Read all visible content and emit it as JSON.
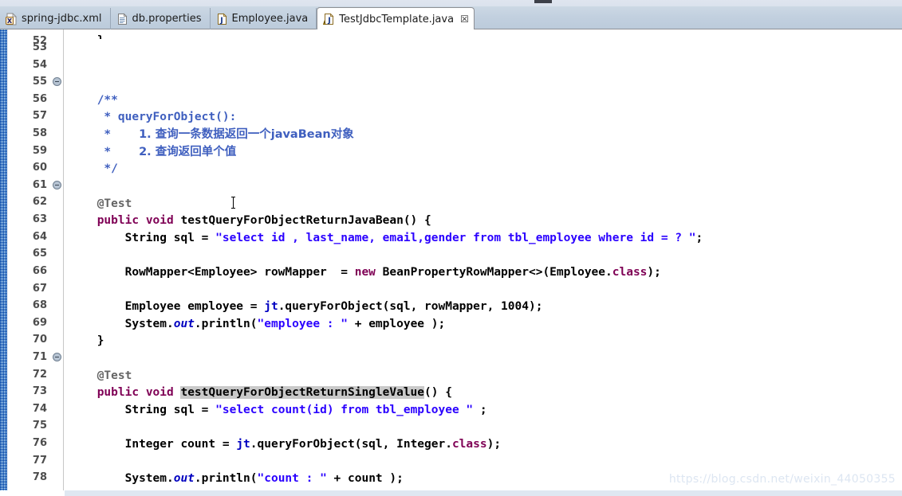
{
  "window": {
    "tabs": [
      {
        "label": "spring-jdbc.xml",
        "icon": "xml-file-icon",
        "active": false,
        "closable": false
      },
      {
        "label": "db.properties",
        "icon": "properties-file-icon",
        "active": false,
        "closable": false
      },
      {
        "label": "Employee.java",
        "icon": "java-file-icon",
        "active": false,
        "closable": false
      },
      {
        "label": "TestJdbcTemplate.java",
        "icon": "java-file-warning-icon",
        "active": true,
        "closable": true
      }
    ],
    "close_glyph": "☒"
  },
  "editor": {
    "first_visible_line": 52,
    "last_visible_line": 78,
    "highlighted_occurrence": "testQueryForObjectReturnSingleValue",
    "lines": [
      {
        "n": 52,
        "fold": false,
        "partial": true,
        "text": "    }"
      },
      {
        "n": 53,
        "fold": false,
        "text": ""
      },
      {
        "n": 54,
        "fold": false,
        "text": ""
      },
      {
        "n": 55,
        "fold": true,
        "text": "    /**"
      },
      {
        "n": 56,
        "fold": false,
        "text": "     * queryForObject():"
      },
      {
        "n": 57,
        "fold": false,
        "text": "     *    1. 查询一条数据返回一个javaBean对象"
      },
      {
        "n": 58,
        "fold": false,
        "text": "     *    2. 查询返回单个值"
      },
      {
        "n": 59,
        "fold": false,
        "text": "     */"
      },
      {
        "n": 60,
        "fold": false,
        "text": ""
      },
      {
        "n": 61,
        "fold": true,
        "text": "    @Test"
      },
      {
        "n": 62,
        "fold": false,
        "text": "    public void testQueryForObjectReturnJavaBean() {"
      },
      {
        "n": 63,
        "fold": false,
        "text": "        String sql = \"select id , last_name, email,gender from tbl_employee where id = ? \";"
      },
      {
        "n": 64,
        "fold": false,
        "text": ""
      },
      {
        "n": 65,
        "fold": false,
        "text": "        RowMapper<Employee> rowMapper  = new BeanPropertyRowMapper<>(Employee.class);"
      },
      {
        "n": 66,
        "fold": false,
        "text": ""
      },
      {
        "n": 67,
        "fold": false,
        "text": "        Employee employee = jt.queryForObject(sql, rowMapper, 1004);"
      },
      {
        "n": 68,
        "fold": false,
        "text": "        System.out.println(\"employee : \" + employee );"
      },
      {
        "n": 69,
        "fold": false,
        "text": "    }"
      },
      {
        "n": 70,
        "fold": false,
        "text": ""
      },
      {
        "n": 71,
        "fold": true,
        "text": "    @Test"
      },
      {
        "n": 72,
        "fold": false,
        "text": "    public void testQueryForObjectReturnSingleValue() {"
      },
      {
        "n": 73,
        "fold": false,
        "text": "        String sql = \"select count(id) from tbl_employee \" ;"
      },
      {
        "n": 74,
        "fold": false,
        "text": ""
      },
      {
        "n": 75,
        "fold": false,
        "text": "        Integer count = jt.queryForObject(sql, Integer.class);"
      },
      {
        "n": 76,
        "fold": false,
        "text": ""
      },
      {
        "n": 77,
        "fold": false,
        "text": "        System.out.println(\"count : \" + count );"
      },
      {
        "n": 78,
        "fold": false,
        "text": "    }"
      }
    ],
    "tokens": {
      "l52": {
        "brace": "}"
      },
      "l55": {
        "javadoc_open": "/**"
      },
      "l56": {
        "star": "*",
        "text": "queryForObject():"
      },
      "l57": {
        "star": "*",
        "text": "1. 查询一条数据返回一个javaBean对象"
      },
      "l58": {
        "star": "*",
        "text": "2. 查询返回单个值"
      },
      "l59": {
        "javadoc_close": "*/"
      },
      "l61": {
        "annotation": "@Test"
      },
      "l62": {
        "kw1": "public",
        "kw2": "void",
        "name": "testQueryForObjectReturnJavaBean",
        "tail": "() {"
      },
      "l63": {
        "type": "String",
        "var": "sql",
        "eq": " = ",
        "string": "\"select id , last_name, email,gender from tbl_employee where id = ? \"",
        "semi": ";"
      },
      "l65": {
        "type": "RowMapper<Employee>",
        "var": "rowMapper",
        "eq": "  = ",
        "kw": "new",
        "ctor": "BeanPropertyRowMapper<>(Employee.",
        "clskw": "class",
        "tail": ");"
      },
      "l67": {
        "type": "Employee",
        "var": "employee",
        "eq": " = ",
        "field": "jt",
        "call": ".queryForObject(sql, rowMapper, 1004);"
      },
      "l68": {
        "sys": "System.",
        "out": "out",
        "print": ".println(",
        "string": "\"employee : \"",
        "tail": " + employee );"
      },
      "l69": {
        "brace": "}"
      },
      "l71": {
        "annotation": "@Test"
      },
      "l72": {
        "kw1": "public",
        "kw2": "void",
        "name": "testQueryForObjectReturnSingleValue",
        "tail": "() {"
      },
      "l73": {
        "type": "String",
        "var": "sql",
        "eq": " = ",
        "string": "\"select count(id) from tbl_employee \"",
        "semi": " ;"
      },
      "l75": {
        "type": "Integer",
        "var": "count",
        "eq": " = ",
        "field": "jt",
        "call": ".queryForObject(sql, Integer.",
        "clskw": "class",
        "tail": ");"
      },
      "l77": {
        "sys": "System.",
        "out": "out",
        "print": ".println(",
        "string": "\"count : \"",
        "tail": " + count );"
      },
      "l78": {
        "brace": "}"
      }
    }
  },
  "watermark": {
    "text": "https://blog.csdn.net/weixin_44050355"
  },
  "colors": {
    "keyword": "#7f0055",
    "string": "#2a00ff",
    "comment": "#3f5fbf",
    "field": "#0000c0",
    "annotation": "#646464",
    "occurrence_highlight": "#c9c9c9",
    "tabbar": "#c2d0df",
    "annotation_strip": "#1b6fc4"
  }
}
